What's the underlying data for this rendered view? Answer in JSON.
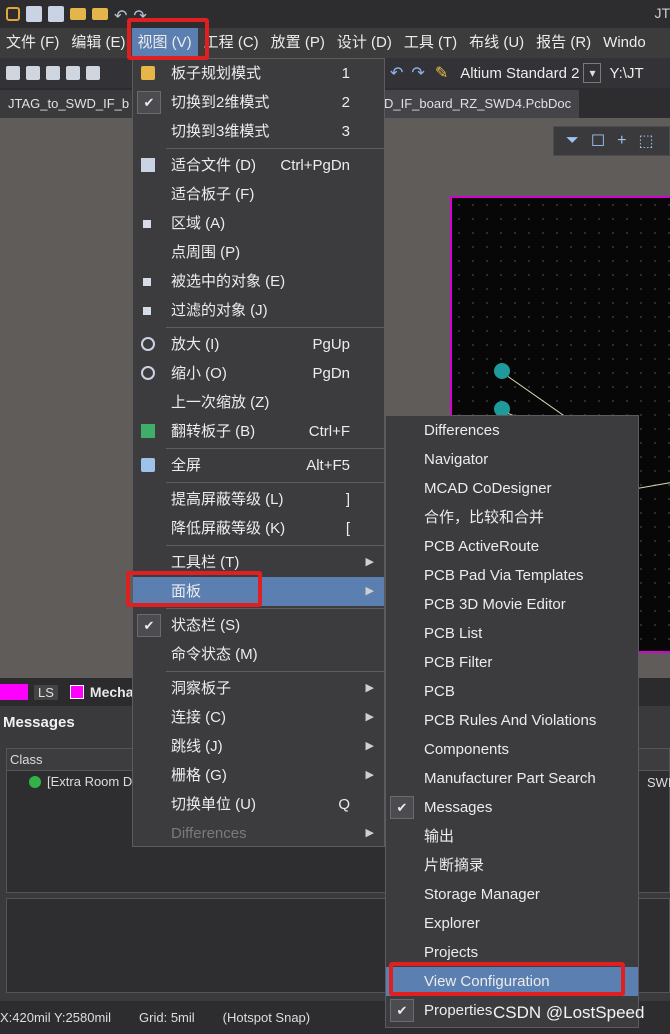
{
  "app": {
    "title_fragment": "JT"
  },
  "menubar": {
    "items": [
      {
        "label": "文件 (F)"
      },
      {
        "label": "编辑 (E)"
      },
      {
        "label": "视图 (V)"
      },
      {
        "label": "工程 (C)"
      },
      {
        "label": "放置 (P)"
      },
      {
        "label": "设计 (D)"
      },
      {
        "label": "工具 (T)"
      },
      {
        "label": "布线 (U)"
      },
      {
        "label": "报告 (R)"
      },
      {
        "label": "Windo"
      }
    ]
  },
  "toolbar": {
    "standard_label": "Altium Standard 2",
    "path": "Y:\\JT"
  },
  "tabs": [
    {
      "label": "JTAG_to_SWD_IF_b"
    },
    {
      "label": "D_IF_board_RZ_SWD4.PcbDoc"
    }
  ],
  "layers": {
    "layer1": "LS",
    "layer2": "Mecha"
  },
  "messages": {
    "title": "Messages",
    "column_class": "Class",
    "row1": "[Extra Room D",
    "row1_right": "SWD"
  },
  "status": {
    "coords": "X:420mil Y:2580mil",
    "grid": "Grid: 5mil",
    "snap": "(Hotspot Snap)"
  },
  "view_menu": {
    "items": [
      {
        "label": "板子规划模式",
        "shortcut": "1"
      },
      {
        "label": "切换到2维模式",
        "shortcut": "2",
        "checked": true
      },
      {
        "label": "切换到3维模式",
        "shortcut": "3"
      },
      {
        "label": "适合文件 (D)",
        "shortcut": "Ctrl+PgDn"
      },
      {
        "label": "适合板子 (F)"
      },
      {
        "label": "区域 (A)"
      },
      {
        "label": "点周围 (P)"
      },
      {
        "label": "被选中的对象 (E)"
      },
      {
        "label": "过滤的对象 (J)"
      },
      {
        "label": "放大 (I)",
        "shortcut": "PgUp"
      },
      {
        "label": "缩小 (O)",
        "shortcut": "PgDn"
      },
      {
        "label": "上一次缩放 (Z)"
      },
      {
        "label": "翻转板子 (B)",
        "shortcut": "Ctrl+F"
      },
      {
        "label": "全屏",
        "shortcut": "Alt+F5"
      },
      {
        "label": "提高屏蔽等级 (L)",
        "shortcut": "]"
      },
      {
        "label": "降低屏蔽等级 (K)",
        "shortcut": "["
      },
      {
        "label": "工具栏 (T)"
      },
      {
        "label": "面板"
      },
      {
        "label": "状态栏 (S)",
        "checked": true
      },
      {
        "label": "命令状态 (M)"
      },
      {
        "label": "洞察板子"
      },
      {
        "label": "连接 (C)"
      },
      {
        "label": "跳线 (J)"
      },
      {
        "label": "栅格 (G)"
      },
      {
        "label": "切换单位 (U)",
        "shortcut": "Q"
      },
      {
        "label": "Differences"
      }
    ]
  },
  "panels_submenu": {
    "items": [
      {
        "label": "Differences"
      },
      {
        "label": "Navigator"
      },
      {
        "label": "MCAD CoDesigner"
      },
      {
        "label": "合作，比较和合并"
      },
      {
        "label": "PCB ActiveRoute"
      },
      {
        "label": "PCB Pad Via Templates"
      },
      {
        "label": "PCB 3D Movie Editor"
      },
      {
        "label": "PCB List"
      },
      {
        "label": "PCB Filter"
      },
      {
        "label": "PCB"
      },
      {
        "label": "PCB Rules And Violations"
      },
      {
        "label": "Components"
      },
      {
        "label": "Manufacturer Part Search"
      },
      {
        "label": "Messages",
        "checked": true
      },
      {
        "label": "输出"
      },
      {
        "label": "片断摘录"
      },
      {
        "label": "Storage Manager"
      },
      {
        "label": "Explorer"
      },
      {
        "label": "Projects"
      },
      {
        "label": "View Configuration"
      },
      {
        "label": "Properties",
        "checked": true
      }
    ]
  },
  "watermark": "CSDN @LostSpeed",
  "colors": {
    "highlight": "#5a7fb0",
    "annotation_red": "#e02020",
    "board_outline": "#d400d4",
    "pad": "#1e9a9a"
  }
}
